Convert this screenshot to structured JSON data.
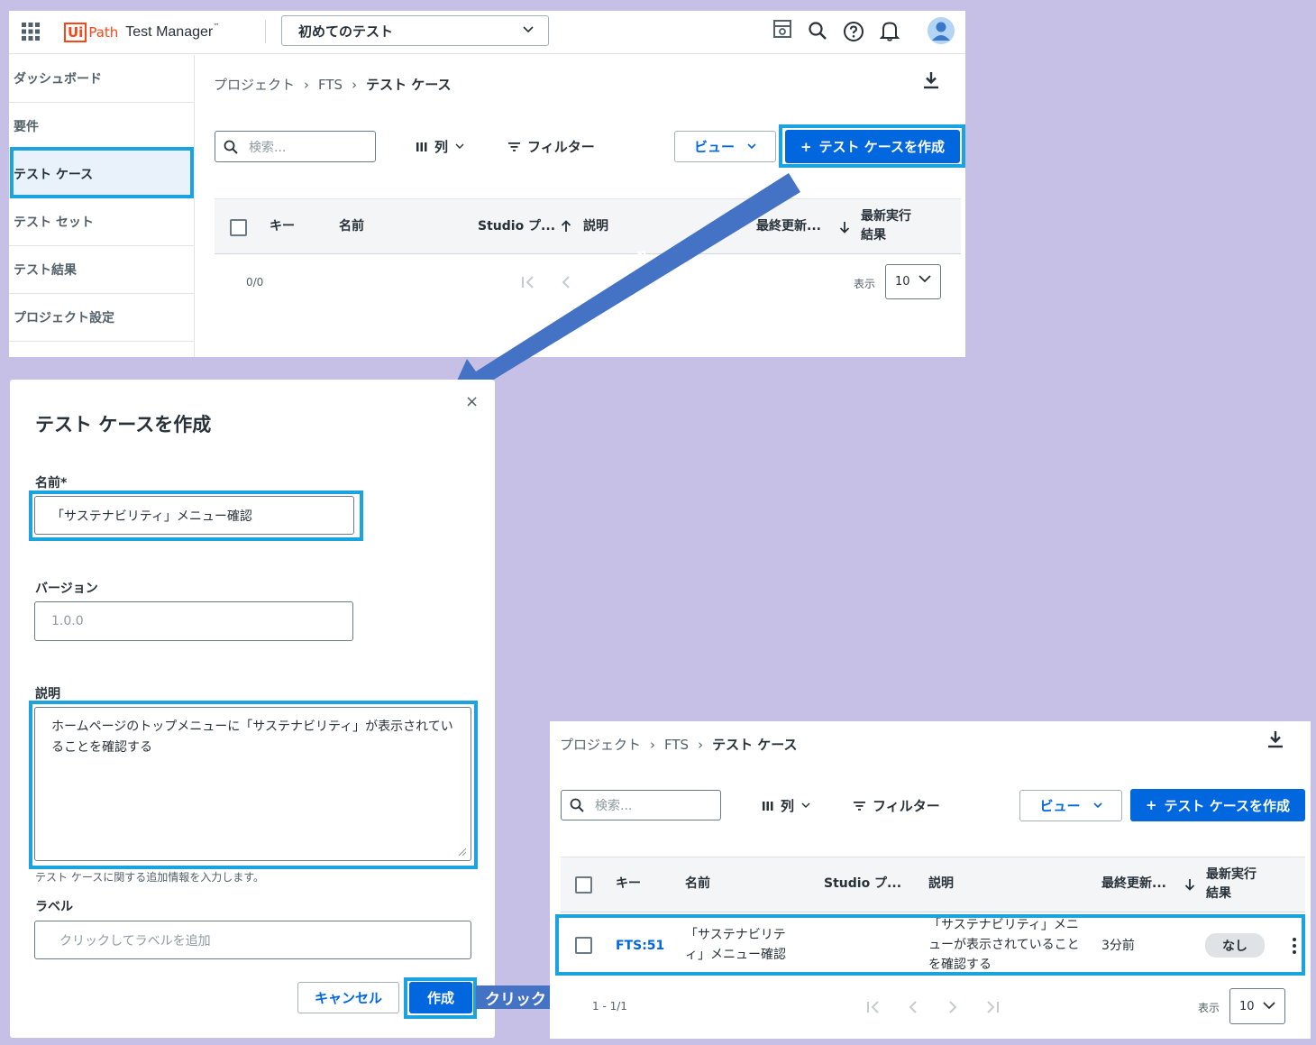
{
  "app": {
    "brand_ui": "Ui",
    "brand_path": "Path",
    "product": "Test Manager",
    "product_tm": "™",
    "tenant": "初めてのテスト"
  },
  "sidebar": {
    "items": [
      {
        "label": "ダッシュボード"
      },
      {
        "label": "要件"
      },
      {
        "label": "テスト ケース"
      },
      {
        "label": "テスト セット"
      },
      {
        "label": "テスト結果"
      },
      {
        "label": "プロジェクト設定"
      }
    ]
  },
  "breadcrumb": {
    "project": "プロジェクト",
    "sep": "›",
    "fts": "FTS",
    "current": "テスト ケース"
  },
  "toolbar": {
    "search_placeholder": "検索...",
    "columns": "列",
    "filter": "フィルター",
    "view": "ビュー",
    "create": "テスト ケースを作成",
    "create_plus": "+"
  },
  "table": {
    "headers": {
      "key": "キー",
      "name": "名前",
      "studio": "Studio プ...",
      "description": "説明",
      "updated": "最終更新...",
      "result_line1": "最新実行",
      "result_line2": "結果"
    },
    "empty_count": "0/0",
    "show_label": "表示",
    "page_size": "10"
  },
  "dialog": {
    "title": "テスト ケースを作成",
    "close": "×",
    "name_label": "名前*",
    "name_value": "「サステナビリティ」メニュー確認",
    "version_label": "バージョン",
    "version_placeholder": "1.0.0",
    "description_label": "説明",
    "description_value": "ホームページのトップメニューに「サステナビリティ」が表示されていることを確認する",
    "description_hint": "テスト ケースに関する追加情報を入力します。",
    "label_label": "ラベル",
    "label_placeholder": "クリックしてラベルを追加",
    "cancel": "キャンセル",
    "create": "作成"
  },
  "result_table": {
    "row": {
      "key": "FTS:51",
      "name": "「サステナビリティ」メニュー確認",
      "description": "「サステナビリティ」メニューが表示されていることを確認する",
      "updated": "3分前",
      "result": "なし"
    },
    "count": "1 - 1/1",
    "show_label": "表示",
    "page_size": "10"
  },
  "annotations": {
    "click1": "クリック",
    "click2": "クリック"
  },
  "colors": {
    "primary": "#0067df",
    "highlight": "#1ba3e0",
    "arrow": "#4472c4",
    "background": "#c7c0e6",
    "brand": "#fa4616"
  }
}
